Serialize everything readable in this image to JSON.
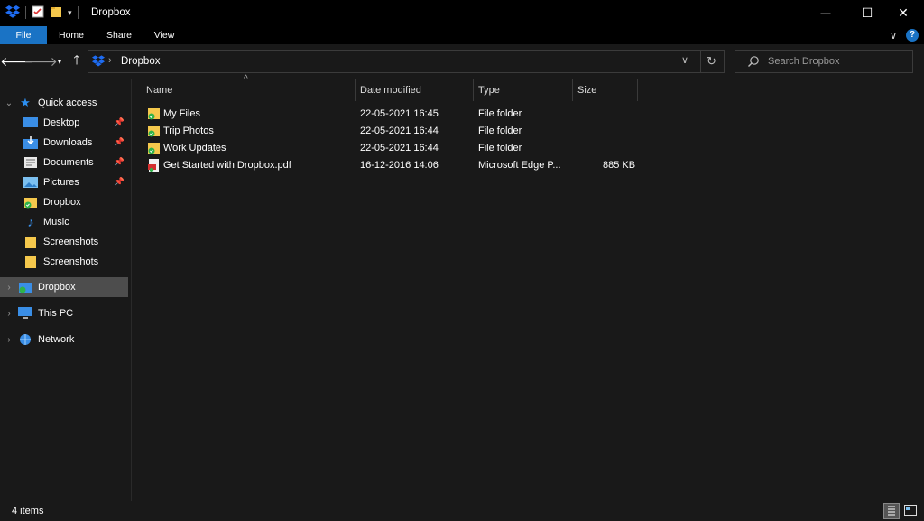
{
  "window": {
    "title": "Dropbox",
    "minimize_glyph": "—",
    "maximize_glyph": "☐",
    "close_glyph": "✕"
  },
  "ribbon": {
    "tabs": [
      "File",
      "Home",
      "Share",
      "View"
    ],
    "help_glyph": "?"
  },
  "nav": {
    "address_path": "Dropbox",
    "search_placeholder": "Search Dropbox"
  },
  "sidebar": {
    "quick_access": "Quick access",
    "quick_items": [
      {
        "label": "Desktop",
        "icon": "desktop-icon",
        "pinned": true
      },
      {
        "label": "Downloads",
        "icon": "downloads-icon",
        "pinned": true
      },
      {
        "label": "Documents",
        "icon": "documents-icon",
        "pinned": true
      },
      {
        "label": "Pictures",
        "icon": "pictures-icon",
        "pinned": true
      },
      {
        "label": "Dropbox",
        "icon": "dropbox-folder-icon",
        "pinned": false
      },
      {
        "label": "Music",
        "icon": "music-icon",
        "pinned": false
      },
      {
        "label": "Screenshots",
        "icon": "folder-icon",
        "pinned": false
      },
      {
        "label": "Screenshots",
        "icon": "folder-icon",
        "pinned": false
      }
    ],
    "roots": [
      {
        "label": "Dropbox",
        "icon": "dropbox-icon",
        "selected": true
      },
      {
        "label": "This PC",
        "icon": "computer-icon",
        "selected": false
      },
      {
        "label": "Network",
        "icon": "network-icon",
        "selected": false
      }
    ]
  },
  "columns": {
    "name": "Name",
    "date": "Date modified",
    "type": "Type",
    "size": "Size"
  },
  "files": [
    {
      "name": "My Files",
      "date": "22-05-2021 16:45",
      "type": "File folder",
      "size": "",
      "icon": "synced-folder-icon"
    },
    {
      "name": "Trip Photos",
      "date": "22-05-2021 16:44",
      "type": "File folder",
      "size": "",
      "icon": "synced-folder-icon"
    },
    {
      "name": "Work Updates",
      "date": "22-05-2021 16:44",
      "type": "File folder",
      "size": "",
      "icon": "synced-folder-icon"
    },
    {
      "name": "Get Started with Dropbox.pdf",
      "date": "16-12-2016 14:06",
      "type": "Microsoft Edge P...",
      "size": "885 KB",
      "icon": "pdf-file-icon"
    }
  ],
  "status": {
    "item_count": "4 items"
  },
  "colors": {
    "accent": "#1a73c5",
    "background": "#191919",
    "titlebar": "#000000",
    "folder_yellow": "#f5c84c",
    "sync_green": "#2fb24a",
    "dropbox_blue": "#1e6cf2"
  }
}
